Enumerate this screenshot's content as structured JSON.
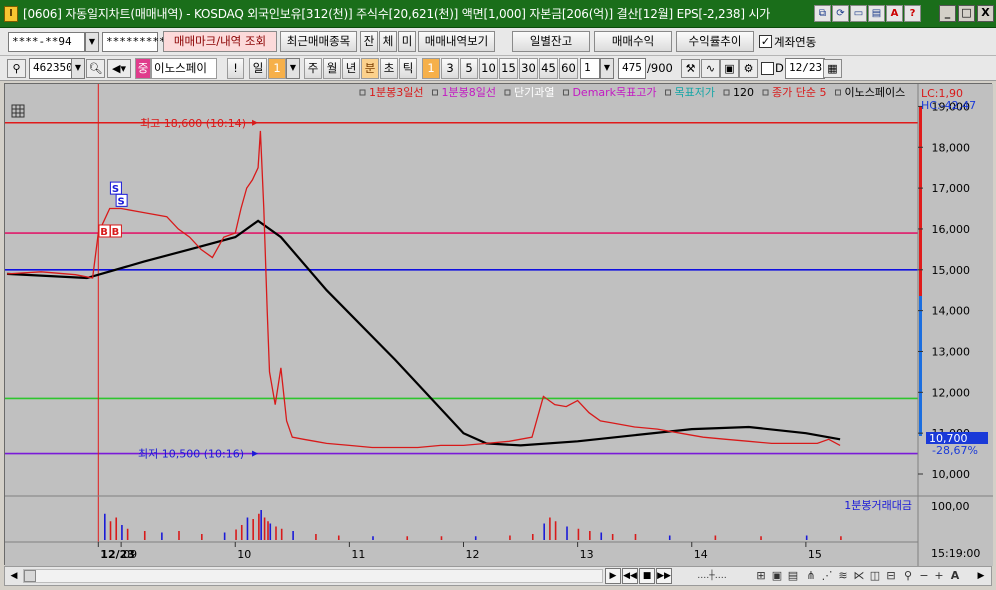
{
  "window": {
    "app_icon": "I",
    "title": "[0606] 자동일지차트(매매내역) - KOSDAQ 외국인보유[312(천)] 주식수[20,621(천)] 액면[1,000] 자본금[206(억)] 결산[12월] EPS[-2,238] 시가",
    "title_tools": [
      "link-icon",
      "refresh-icon",
      "window-icon",
      "split-icon",
      "pdf-icon",
      "help-icon"
    ],
    "help_label": "?",
    "pdf_label": "A",
    "minimize": "_",
    "maximize": "□",
    "close": "X"
  },
  "toolbar1": {
    "account_value": "****-**94",
    "password_value": "*********",
    "trade_mark_btn": "매매마크/내역 조회",
    "recent_btn": "최근매매종목",
    "jan_btn": "잔",
    "che_btn": "체",
    "mi_btn": "미",
    "history_btn": "매매내역보기",
    "daily_balance_btn": "일별잔고",
    "trade_profit_btn": "매매수익",
    "return_trend_btn": "수익률추이",
    "account_link_checked": "✓",
    "account_link_label": "계좌연동"
  },
  "toolbar2": {
    "code_value": "462350",
    "stock_tag": "중",
    "stock_name": "이노스페이",
    "exclaim": "!",
    "period_il": "일",
    "period_value": "1",
    "periods": [
      "주",
      "월",
      "년"
    ],
    "unit_bun": "분",
    "unit_cho": "초",
    "unit_tik": "틱",
    "minute_buttons": [
      "1",
      "3",
      "5",
      "10",
      "15",
      "30",
      "45",
      "60"
    ],
    "count_value": "1",
    "bars_value": "475",
    "bars_max": "/900",
    "checkbox_label": "D",
    "date_value": "12/23"
  },
  "chart_data": {
    "type": "line",
    "title": "",
    "legend": [
      {
        "name": "1분봉3일선",
        "color": "#d81a1a"
      },
      {
        "name": "1분봉8일선",
        "color": "#c21ac2"
      },
      {
        "name": "단기과열",
        "color": "#ffffff"
      },
      {
        "name": "Demark목표고가",
        "color": "#c21ac2"
      },
      {
        "name": "목표저가",
        "color": "#16a6a6"
      },
      {
        "name": "120",
        "color": "#000000"
      },
      {
        "name": "종가 단순 5",
        "color": "#d81a1a"
      },
      {
        "name": "이노스페이스",
        "color": "#000000"
      }
    ],
    "lc_label": "LC:1,90",
    "hc_label": "HC:-42,47",
    "y_ticks": [
      "19,000",
      "18,000",
      "17,000",
      "16,000",
      "15,000",
      "14,000",
      "13,000",
      "12,000",
      "11,000",
      "10,000"
    ],
    "ylim": [
      10000,
      19500
    ],
    "current_price": "10,700",
    "current_change": "-28,67%",
    "high_annotation": "최고 18,600 (10:14)",
    "low_annotation": "최저 10,500 (10:16)",
    "high_value": 18600,
    "low_value": 10500,
    "hlines": [
      {
        "value": 18600,
        "color": "#e01a1a"
      },
      {
        "value": 15900,
        "color": "#e01a6a"
      },
      {
        "value": 15000,
        "color": "#1010e0"
      },
      {
        "value": 11850,
        "color": "#2ec52e"
      },
      {
        "value": 10500,
        "color": "#7a1ad8"
      }
    ],
    "x_ticks": [
      "12/23",
      "09",
      "10",
      "11",
      "12",
      "13",
      "14",
      "15"
    ],
    "x_hours": [
      8.8,
      9,
      10,
      11,
      12,
      13,
      14,
      15
    ],
    "price_series": {
      "name": "이노스페이스",
      "x": [
        8.0,
        8.3,
        8.6,
        8.75,
        8.8,
        8.85,
        8.9,
        9.0,
        9.2,
        9.4,
        9.5,
        9.6,
        9.7,
        9.8,
        9.9,
        10.0,
        10.05,
        10.1,
        10.15,
        10.2,
        10.22,
        10.25,
        10.28,
        10.3,
        10.35,
        10.4,
        10.45,
        10.5,
        10.6,
        10.7,
        10.8,
        11.0,
        11.2,
        11.4,
        11.6,
        11.8,
        12.0,
        12.2,
        12.4,
        12.6,
        12.7,
        12.8,
        12.9,
        13.0,
        13.1,
        13.2,
        13.3,
        13.5,
        13.7,
        13.9,
        14.1,
        14.3,
        14.5,
        14.7,
        14.9,
        15.1,
        15.2,
        15.3
      ],
      "y": [
        14900,
        14950,
        14880,
        14800,
        15900,
        16200,
        16500,
        16500,
        16400,
        16300,
        16000,
        15800,
        15500,
        15300,
        15800,
        15900,
        16500,
        17000,
        17200,
        17500,
        18400,
        16500,
        14000,
        12500,
        11700,
        12600,
        11300,
        10900,
        10850,
        10800,
        10750,
        10700,
        10650,
        10650,
        10650,
        10700,
        10700,
        10750,
        10800,
        10900,
        11900,
        11700,
        11650,
        11800,
        11500,
        11300,
        11250,
        11150,
        11100,
        11000,
        10900,
        10850,
        10800,
        10750,
        10750,
        10750,
        10850,
        10700
      ]
    },
    "ma_series": {
      "name": "120",
      "x": [
        8.0,
        8.7,
        9.2,
        9.6,
        10.0,
        10.2,
        10.4,
        10.8,
        11.4,
        12.0,
        12.2,
        12.5,
        13.0,
        13.5,
        14.0,
        14.5,
        15.0,
        15.3
      ],
      "y": [
        14900,
        14800,
        15200,
        15500,
        15800,
        16200,
        15800,
        14500,
        12800,
        11000,
        10750,
        10700,
        10800,
        10950,
        11100,
        11150,
        11000,
        10850
      ]
    },
    "signals": [
      {
        "label": "S",
        "type": "sell",
        "x": 8.95,
        "y": 17000
      },
      {
        "label": "S",
        "type": "sell",
        "x": 9.0,
        "y": 16700
      },
      {
        "label": "B",
        "type": "buy",
        "x": 8.85,
        "y": 15950
      },
      {
        "label": "B",
        "type": "buy",
        "x": 8.95,
        "y": 15950
      }
    ],
    "volume_label": "1분봉거래대금",
    "volume_tick": "100,00",
    "time_label": "15:19:00",
    "volume_series": {
      "x": [
        8.85,
        8.9,
        8.95,
        9.0,
        9.05,
        9.2,
        9.35,
        9.5,
        9.7,
        9.9,
        10.0,
        10.05,
        10.1,
        10.15,
        10.2,
        10.22,
        10.25,
        10.28,
        10.3,
        10.35,
        10.4,
        10.5,
        10.7,
        10.9,
        11.2,
        11.5,
        11.8,
        12.1,
        12.4,
        12.6,
        12.7,
        12.75,
        12.8,
        12.9,
        13.0,
        13.1,
        13.2,
        13.3,
        13.5,
        13.8,
        14.2,
        14.6,
        15.0,
        15.3
      ],
      "y": [
        35,
        25,
        30,
        20,
        15,
        12,
        10,
        12,
        8,
        10,
        14,
        20,
        30,
        28,
        35,
        40,
        30,
        25,
        22,
        18,
        15,
        12,
        8,
        6,
        5,
        5,
        5,
        5,
        6,
        8,
        22,
        30,
        25,
        18,
        15,
        12,
        10,
        8,
        8,
        6,
        6,
        5,
        6,
        5
      ]
    }
  },
  "scrollbar": {
    "left_arrow": "◀",
    "right_arrow": "▶",
    "nav_buttons": [
      "▶",
      "◀◀",
      "■",
      "▶▶"
    ],
    "zoom_out": "−",
    "zoom_in": "+",
    "font_label": "A"
  }
}
